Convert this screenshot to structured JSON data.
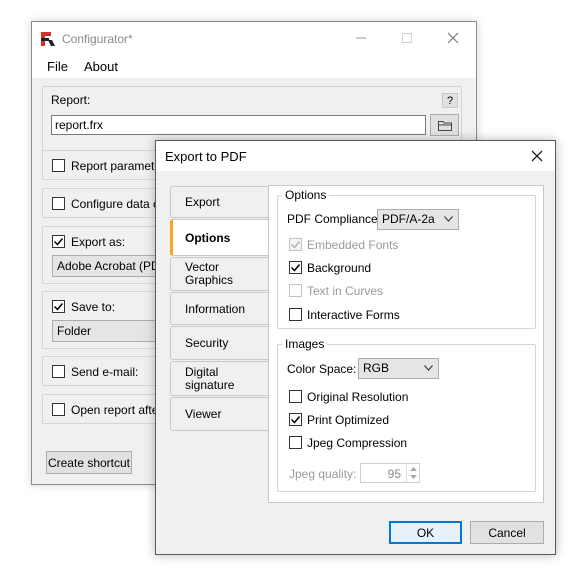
{
  "configurator": {
    "title": "Configurator*",
    "menu": {
      "file": "File",
      "about": "About"
    },
    "report_label": "Report:",
    "help_label": "?",
    "report_value": "report.frx",
    "report_parameters": "Report parameters",
    "configure_data": "Configure data co",
    "export_as": "Export as:",
    "export_format": "Adobe Acrobat (PDF)",
    "save_to": "Save to:",
    "save_location": "Folder",
    "send_email": "Send e-mail:",
    "open_report": "Open report after b",
    "create_shortcut": "Create shortcut",
    "checked": {
      "report_parameters": false,
      "configure_data": false,
      "export_as": true,
      "save_to": true,
      "send_email": false,
      "open_report": false
    }
  },
  "dialog": {
    "title": "Export to PDF",
    "tabs": [
      {
        "label": "Export"
      },
      {
        "label": "Options"
      },
      {
        "label": "Vector Graphics"
      },
      {
        "label": "Information"
      },
      {
        "label": "Security"
      },
      {
        "label": "Digital signature"
      },
      {
        "label": "Viewer"
      }
    ],
    "active_tab": "Options",
    "options": {
      "legend": "Options",
      "pdf_compliance_label": "PDF Compliance:",
      "pdf_compliance_value": "PDF/A-2a",
      "embedded_fonts": "Embedded Fonts",
      "background": "Background",
      "text_in_curves": "Text in Curves",
      "interactive_forms": "Interactive Forms"
    },
    "images": {
      "legend": "Images",
      "color_space_label": "Color Space:",
      "color_space_value": "RGB",
      "original_resolution": "Original Resolution",
      "print_optimized": "Print Optimized",
      "jpeg_compression": "Jpeg Compression",
      "jpeg_quality_label": "Jpeg quality:",
      "jpeg_quality_value": "95"
    },
    "ok": "OK",
    "cancel": "Cancel"
  },
  "colors": {
    "accent": "#0078d7",
    "tab_highlight": "#f5a623",
    "logo_red": "#d32f2f"
  }
}
